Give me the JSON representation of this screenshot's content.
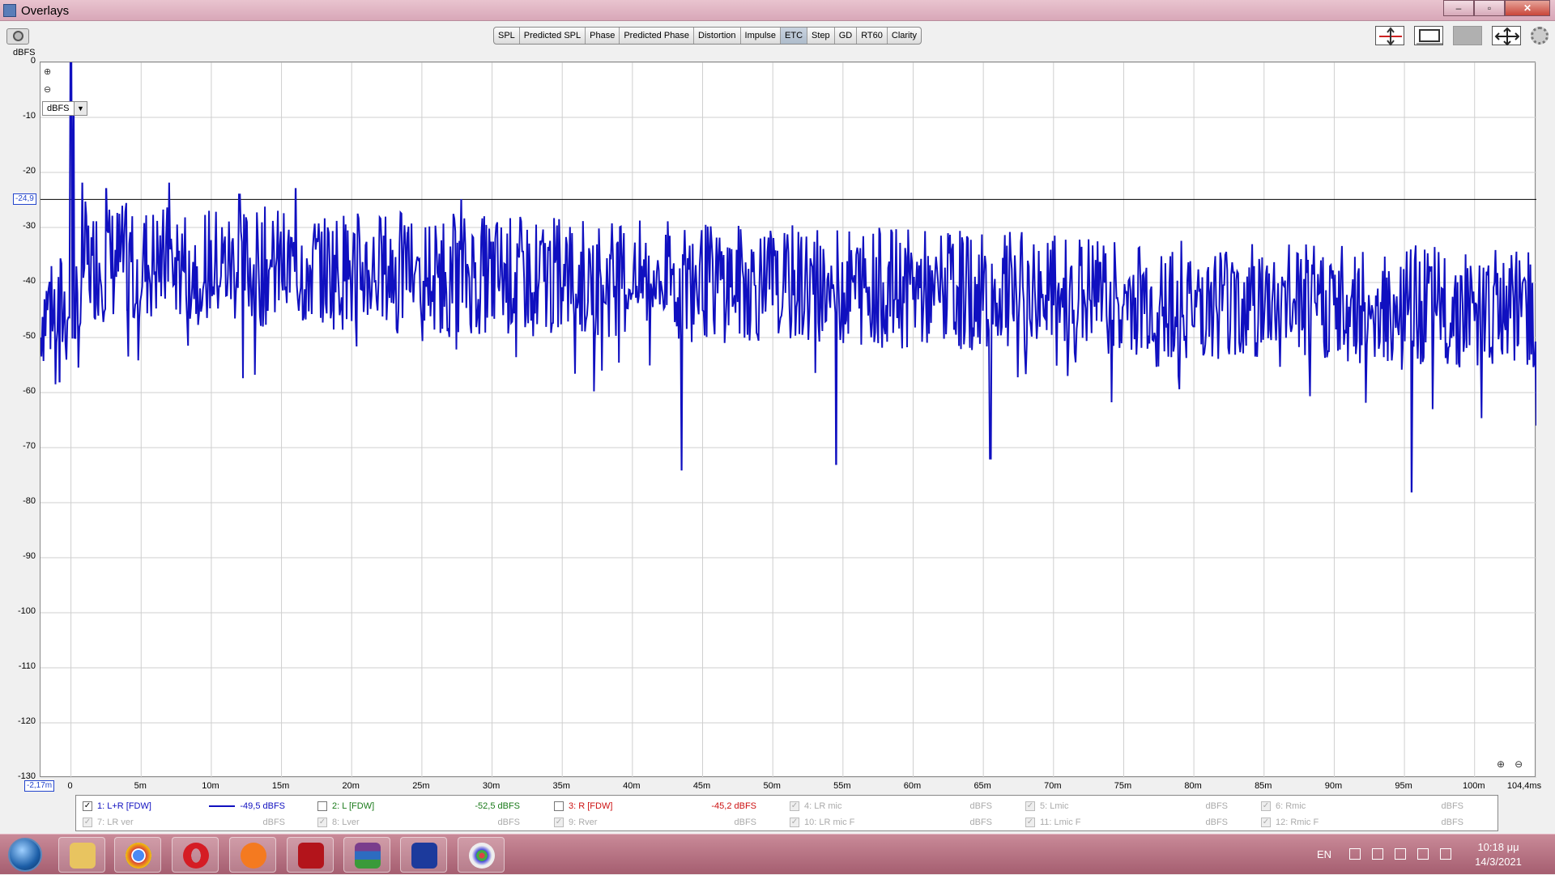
{
  "window": {
    "title": "Overlays",
    "buttons": [
      "–",
      "▫",
      "✕"
    ]
  },
  "toolbar": {
    "tabs": [
      "SPL",
      "Predicted SPL",
      "Phase",
      "Predicted Phase",
      "Distortion",
      "Impulse",
      "ETC",
      "Step",
      "GD",
      "RT60",
      "Clarity"
    ],
    "active_tab": "ETC"
  },
  "plot": {
    "y_unit": "dBFS",
    "unit_selector": "dBFS",
    "cursor_y": "-24,9",
    "cursor_x": "-2,17m"
  },
  "chart_data": {
    "type": "line",
    "ylabel": "dBFS",
    "ylim": [
      -130,
      0
    ],
    "xlim": [
      -0.00217,
      0.1044
    ],
    "yticks": [
      "0",
      "-10",
      "-20",
      "-30",
      "-40",
      "-50",
      "-60",
      "-70",
      "-80",
      "-90",
      "-100",
      "-110",
      "-120",
      "-130"
    ],
    "xticks": [
      "0",
      "5m",
      "10m",
      "15m",
      "20m",
      "25m",
      "30m",
      "35m",
      "40m",
      "45m",
      "50m",
      "55m",
      "60m",
      "65m",
      "70m",
      "75m",
      "80m",
      "85m",
      "90m",
      "95m",
      "100m",
      "104,4ms"
    ],
    "xtick_values": [
      0,
      0.005,
      0.01,
      0.015,
      0.02,
      0.025,
      0.03,
      0.035,
      0.04,
      0.045,
      0.05,
      0.055,
      0.06,
      0.065,
      0.07,
      0.075,
      0.08,
      0.085,
      0.09,
      0.095,
      0.1,
      0.1044
    ],
    "cursor_level": -24.9,
    "series": [
      {
        "name": "1: L+R [FDW]",
        "color": "#1010c0",
        "x": [
          -0.00217,
          -0.0015,
          -0.0008,
          0,
          0.0002,
          0.0008,
          0.0015,
          0.0025,
          0.004,
          0.006,
          0.007,
          0.0095,
          0.012,
          0.014,
          0.016,
          0.02,
          0.024,
          0.0278,
          0.03,
          0.035,
          0.04,
          0.0435,
          0.045,
          0.05,
          0.0545,
          0.06,
          0.0655,
          0.07,
          0.075,
          0.08,
          0.085,
          0.09,
          0.0955,
          0.1,
          0.1044
        ],
        "values": [
          -50,
          -40,
          -58,
          0,
          -9,
          -22,
          -35,
          -23,
          -45,
          -38,
          -22,
          -40,
          -24,
          -45,
          -23,
          -47,
          -31,
          -25,
          -46,
          -41,
          -42,
          -74,
          -45,
          -44,
          -73,
          -43,
          -72,
          -44,
          -44,
          -48,
          -47,
          -44,
          -78,
          -47,
          -66
        ]
      }
    ]
  },
  "legend": [
    {
      "id": "1",
      "label": "1: L+R [FDW]",
      "value": "-49,5 dBFS",
      "checked": true,
      "enabled": true,
      "color": "#1010c0"
    },
    {
      "id": "2",
      "label": "2: L [FDW]",
      "value": "-52,5 dBFS",
      "checked": false,
      "enabled": true,
      "color": "#1a7a1a"
    },
    {
      "id": "3",
      "label": "3: R [FDW]",
      "value": "-45,2 dBFS",
      "checked": false,
      "enabled": true,
      "color": "#cc1010"
    },
    {
      "id": "4",
      "label": "4: LR mic",
      "value": "dBFS",
      "checked": true,
      "enabled": false,
      "color": "#aaaaaa"
    },
    {
      "id": "5",
      "label": "5: Lmic",
      "value": "dBFS",
      "checked": true,
      "enabled": false,
      "color": "#aaaaaa"
    },
    {
      "id": "6",
      "label": "6: Rmic",
      "value": "dBFS",
      "checked": true,
      "enabled": false,
      "color": "#aaaaaa"
    },
    {
      "id": "7",
      "label": "7: LR ver",
      "value": "dBFS",
      "checked": true,
      "enabled": false,
      "color": "#aaaaaa"
    },
    {
      "id": "8",
      "label": "8: Lver",
      "value": "dBFS",
      "checked": true,
      "enabled": false,
      "color": "#aaaaaa"
    },
    {
      "id": "9",
      "label": "9: Rver",
      "value": "dBFS",
      "checked": true,
      "enabled": false,
      "color": "#aaaaaa"
    },
    {
      "id": "10",
      "label": "10: LR mic F",
      "value": "dBFS",
      "checked": true,
      "enabled": false,
      "color": "#aaaaaa"
    },
    {
      "id": "11",
      "label": "11: Lmic F",
      "value": "dBFS",
      "checked": true,
      "enabled": false,
      "color": "#aaaaaa"
    },
    {
      "id": "12",
      "label": "12: Rmic F",
      "value": "dBFS",
      "checked": true,
      "enabled": false,
      "color": "#aaaaaa"
    }
  ],
  "taskbar": {
    "apps": [
      "file-explorer",
      "chrome",
      "opera",
      "brave",
      "media-app",
      "winrar",
      "rew",
      "paint"
    ],
    "language": "EN",
    "time": "10:18 μμ",
    "date": "14/3/2021"
  }
}
